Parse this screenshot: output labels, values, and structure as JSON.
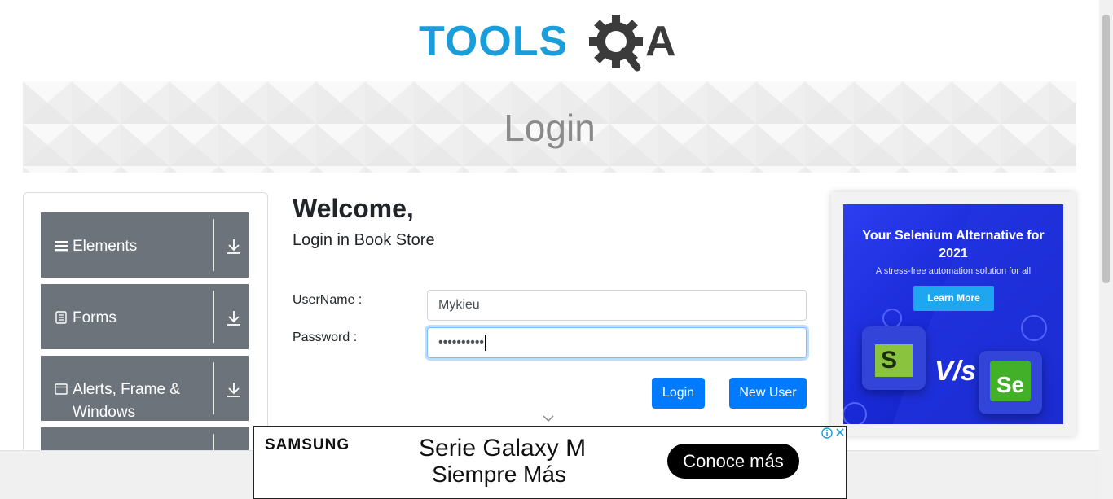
{
  "logo": {
    "text_tools": "TOOLS",
    "text_a": "A",
    "brand_blue": "#1a9dd9",
    "brand_dark": "#3b3b3b"
  },
  "banner": {
    "title": "Login"
  },
  "sidebar": {
    "groups": [
      {
        "label": "Elements",
        "icon": "menu-lines-icon"
      },
      {
        "label": "Forms",
        "icon": "document-icon"
      },
      {
        "label": "Alerts, Frame & Windows",
        "icon": "window-icon"
      },
      {
        "label": "",
        "icon": ""
      }
    ],
    "bg_color": "#6c737b"
  },
  "form": {
    "welcome": "Welcome,",
    "subtitle": "Login in Book Store",
    "username_label": "UserName :",
    "username_value": "Mykieu",
    "password_label": "Password :",
    "password_value": "••••••••••",
    "login_button": "Login",
    "new_user_button": "New User",
    "accent": "#007bff"
  },
  "right_ad": {
    "headline": "Your Selenium Alternative for 2021",
    "tagline": "A stress-free automation solution for all",
    "button": "Learn More",
    "vs_text": "V/s",
    "logo_left": "S",
    "logo_right": "Se"
  },
  "bottom_ad": {
    "brand": "SAMSUNG",
    "line1": "Serie Galaxy M",
    "line2": "Siempre Más",
    "cta": "Conoce más"
  }
}
